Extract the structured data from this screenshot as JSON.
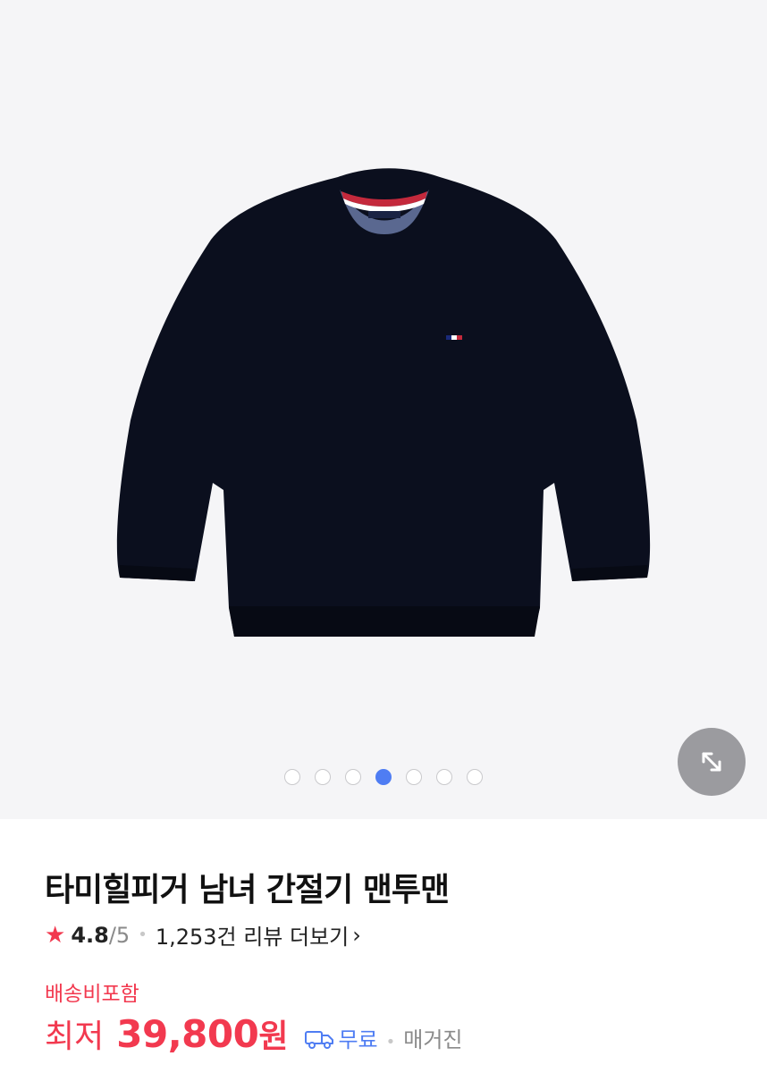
{
  "gallery": {
    "dots_count": 7,
    "active_dot_index": 3
  },
  "product": {
    "title": "타미힐피거 남녀 간절기 맨투맨",
    "rating": "4.8",
    "rating_max": "/5",
    "review_count": "1,253건 리뷰 더보기",
    "shipping_note": "배송비포함",
    "price_label": "최저",
    "price": "39,800",
    "price_unit": "원",
    "shipping": "무료",
    "seller": "매거진"
  },
  "colors": {
    "accent_red": "#f2394f",
    "accent_blue": "#4f7df3"
  },
  "icons": [
    "star-icon",
    "truck-icon",
    "expand-icon",
    "chevron-right-icon"
  ]
}
